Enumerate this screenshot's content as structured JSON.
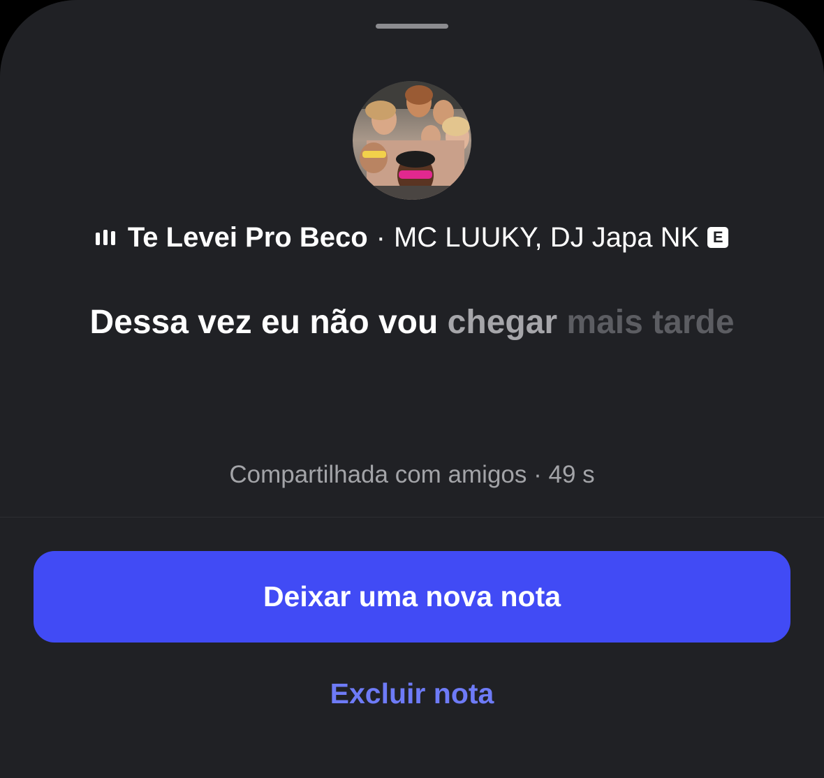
{
  "song": {
    "title": "Te Levei Pro Beco",
    "separator": "·",
    "artists": "MC LUUKY, DJ Japa NK",
    "explicit_badge": "E",
    "playing_icon": "equalizer-icon"
  },
  "note": {
    "lyric_sung": "Dessa vez eu não vou",
    "lyric_current": "chegar",
    "lyric_upcoming": "mais tarde",
    "shared_info": "Compartilhada com amigos · 49 s"
  },
  "actions": {
    "new_note_label": "Deixar uma nova nota",
    "delete_note_label": "Excluir nota"
  },
  "colors": {
    "sheet_background": "#202125",
    "primary_button": "#414bf5",
    "link": "#6e7bf7",
    "muted_text": "#a3a4a8"
  }
}
